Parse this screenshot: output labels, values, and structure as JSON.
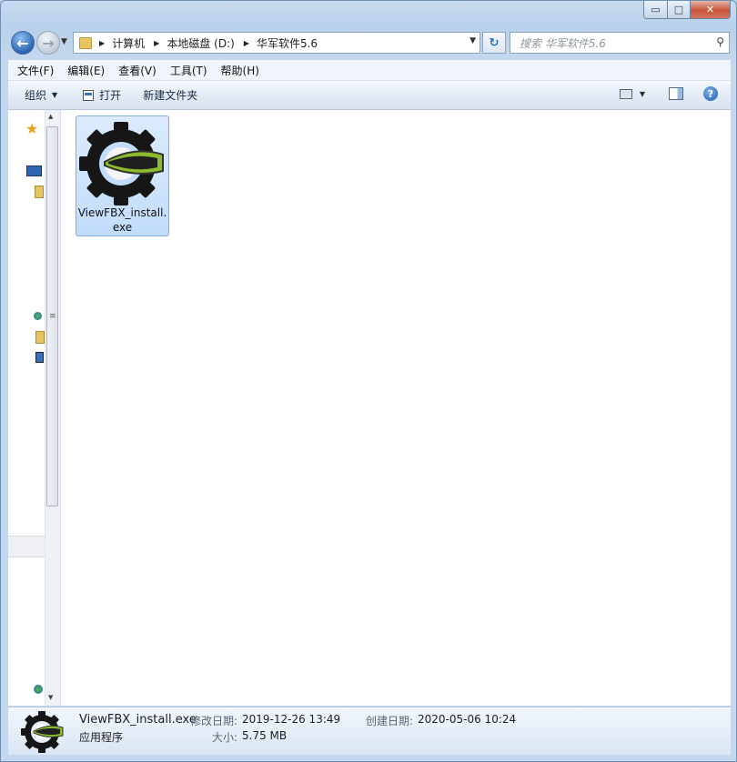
{
  "window": {
    "caption_buttons": {
      "minimize": "▭",
      "maximize": "□",
      "close": "✕"
    }
  },
  "address_bar": {
    "breadcrumbs": [
      "计算机",
      "本地磁盘 (D:)",
      "华军软件5.6"
    ],
    "search_placeholder": "搜索 华军软件5.6"
  },
  "menu": [
    "文件(F)",
    "编辑(E)",
    "查看(V)",
    "工具(T)",
    "帮助(H)"
  ],
  "toolbar": {
    "organize": "组织",
    "open": "打开",
    "new_folder": "新建文件夹",
    "help": "?"
  },
  "files": [
    {
      "name": "ViewFBX_install.exe",
      "icon": "gear-app-icon",
      "selected": true
    }
  ],
  "details": {
    "file_name": "ViewFBX_install.exe",
    "file_type": "应用程序",
    "modified_label": "修改日期:",
    "modified_value": "2019-12-26 13:49",
    "created_label": "创建日期:",
    "created_value": "2020-05-06 10:24",
    "size_label": "大小:",
    "size_value": "5.75 MB"
  },
  "colors": {
    "selection_bg": "#c1dcfc",
    "selection_border": "#84acdd",
    "frame": "#c3d7ee"
  }
}
